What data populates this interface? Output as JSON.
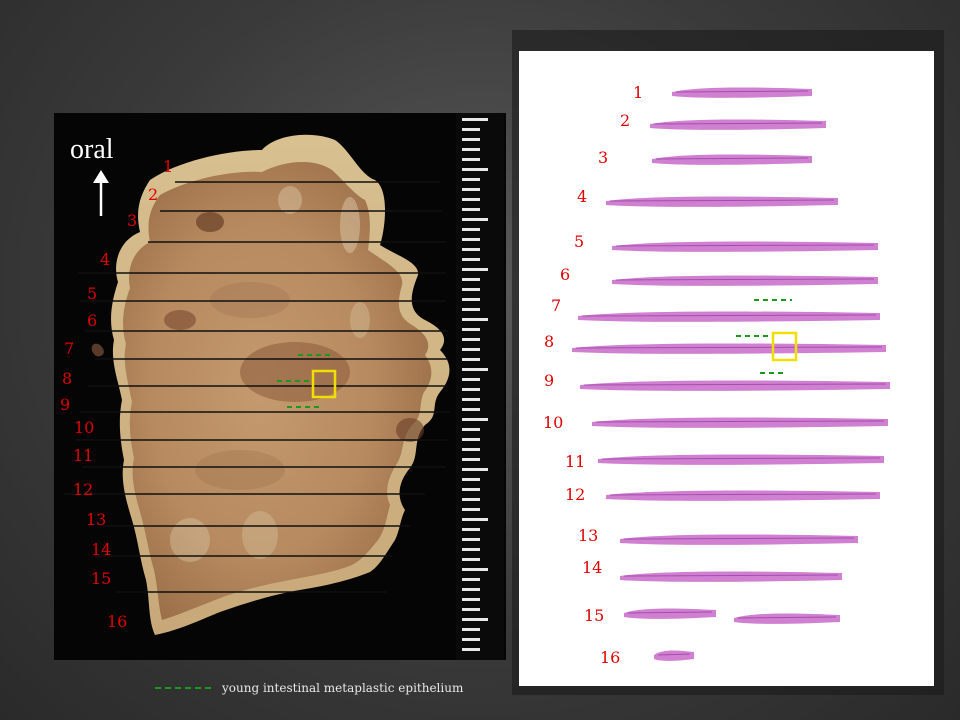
{
  "gross_panel": {
    "orientation_label": "oral",
    "section_numbers": [
      "1",
      "2",
      "3",
      "4",
      "5",
      "6",
      "7",
      "8",
      "9",
      "10",
      "11",
      "12",
      "13",
      "14",
      "15",
      "16"
    ]
  },
  "histology_panel": {
    "section_numbers": [
      "1",
      "2",
      "3",
      "4",
      "5",
      "6",
      "7",
      "8",
      "9",
      "10",
      "11",
      "12",
      "13",
      "14",
      "15",
      "16"
    ]
  },
  "legend": {
    "label": "young intestinal metaplastic epithelium",
    "line_color": "#1a9a1a"
  },
  "colors": {
    "section_number": "#e00000",
    "highlight_box": "#f0e000",
    "metaplasia_marker": "#1a9a1a",
    "tissue_stain": "#c86ac8"
  },
  "icons": {
    "orientation_arrow": "up-arrow-icon"
  }
}
